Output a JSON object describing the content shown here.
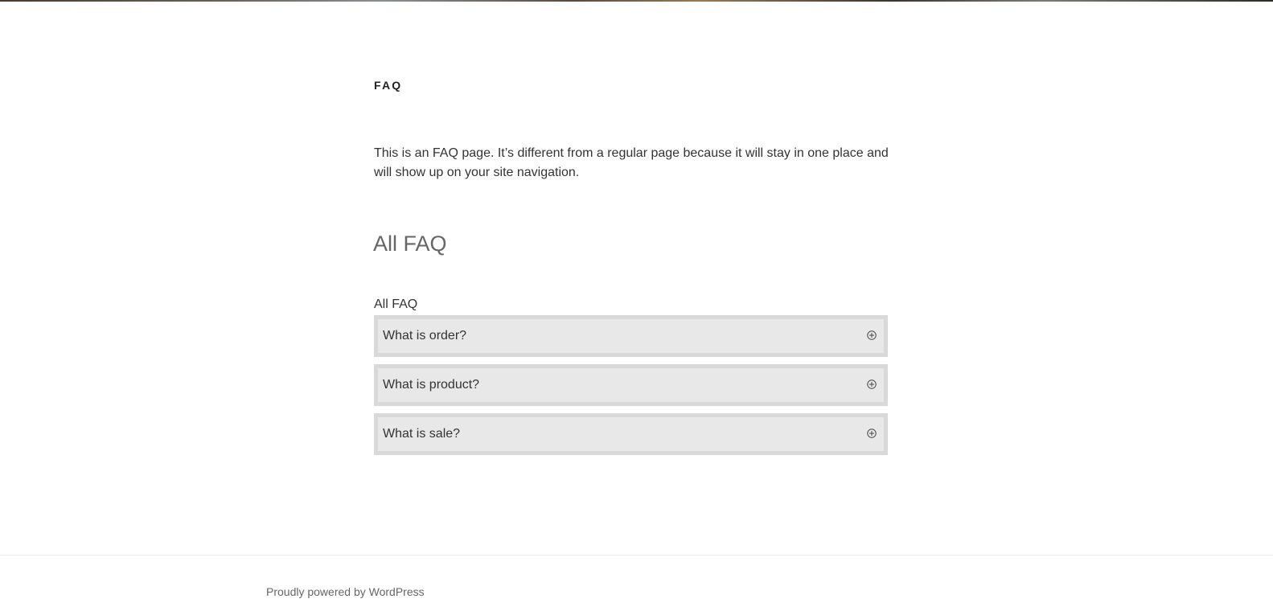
{
  "page": {
    "title": "FAQ",
    "intro": "This is an FAQ page. It’s different from a regular page because it will stay in one place and will show up on your site navigation."
  },
  "faq_section": {
    "heading": "All FAQ",
    "group_label": "All FAQ",
    "items": [
      {
        "question": "What is order?",
        "toggle_icon": "plus-circle-icon"
      },
      {
        "question": "What is product?",
        "toggle_icon": "plus-circle-icon"
      },
      {
        "question": "What is sale?",
        "toggle_icon": "plus-circle-icon"
      }
    ]
  },
  "footer": {
    "credit": "Proudly powered by WordPress"
  },
  "colors": {
    "faq_item_background": "#e8e8e8",
    "faq_item_border": "#d9d9d9",
    "text": "#333333",
    "muted_text": "#666666"
  }
}
